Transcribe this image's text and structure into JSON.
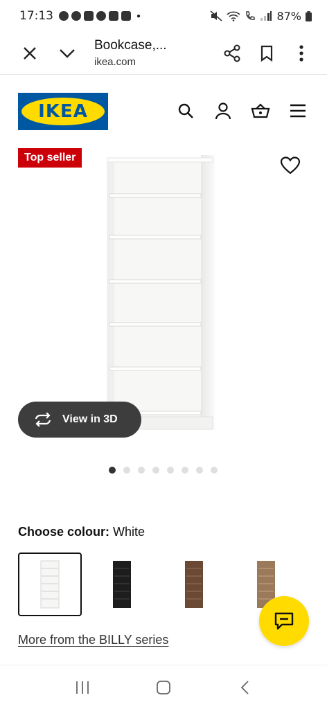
{
  "status_bar": {
    "time": "17:13",
    "battery": "87%"
  },
  "browser": {
    "title": "Bookcase,...",
    "url": "ikea.com"
  },
  "site": {
    "logo_text": "IKEA",
    "brand_blue": "#0058a3",
    "brand_yellow": "#ffdb00"
  },
  "product": {
    "badge": "Top seller",
    "view_3d_label": "View in 3D",
    "image_count": 8,
    "active_image": 1,
    "choose_colour_label": "Choose colour:",
    "selected_colour": "White",
    "swatches": [
      {
        "colour": "#f4f4f2",
        "selected": true
      },
      {
        "colour": "#1d1d1d",
        "selected": false
      },
      {
        "colour": "#6b4a35",
        "selected": false
      },
      {
        "colour": "#9b7a5c",
        "selected": false
      }
    ],
    "more_link": "More from the BILLY series"
  },
  "icons": {
    "header": [
      "search-icon",
      "account-icon",
      "basket-icon",
      "menu-icon"
    ],
    "chat": "chat-icon"
  }
}
